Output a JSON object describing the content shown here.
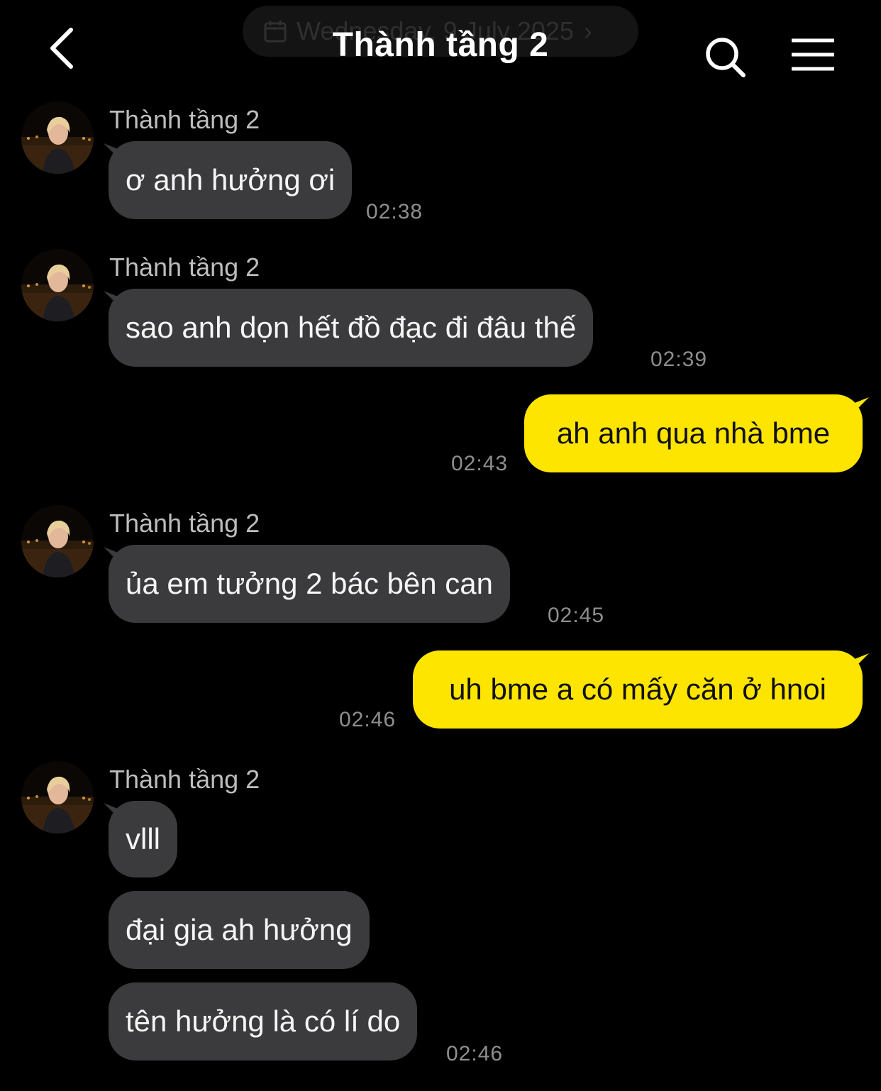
{
  "header": {
    "title": "Thành tầng 2",
    "date_chip": "Wednesday, 9 July 2025"
  },
  "contact": {
    "name": "Thành tầng 2"
  },
  "colors": {
    "background": "#000000",
    "incoming_bubble": "#3b3b3d",
    "outgoing_bubble": "#fee500",
    "timestamp": "#8e8e8e"
  },
  "messages": [
    {
      "sender": "Thành tầng 2",
      "text": "ơ anh hưởng ơi",
      "time": "02:38"
    },
    {
      "sender": "Thành tầng 2",
      "text": "sao anh dọn hết đồ đạc đi đâu thế",
      "time": "02:39"
    },
    {
      "sender": "me",
      "text": "ah anh qua nhà bme",
      "time": "02:43"
    },
    {
      "sender": "Thành tầng 2",
      "text": "ủa em tưởng 2 bác bên can",
      "time": "02:45"
    },
    {
      "sender": "me",
      "text": "uh bme a có mấy căn ở hnoi",
      "time": "02:46"
    },
    {
      "sender": "Thành tầng 2",
      "text": "vlll",
      "time": ""
    },
    {
      "sender": "Thành tầng 2",
      "text": "đại gia ah hưởng",
      "time": ""
    },
    {
      "sender": "Thành tầng 2",
      "text": "tên hưởng là có lí do",
      "time": "02:46"
    }
  ],
  "icons": {
    "back": "chevron-left-icon",
    "search": "search-icon",
    "menu": "hamburger-menu-icon",
    "calendar": "calendar-icon"
  }
}
